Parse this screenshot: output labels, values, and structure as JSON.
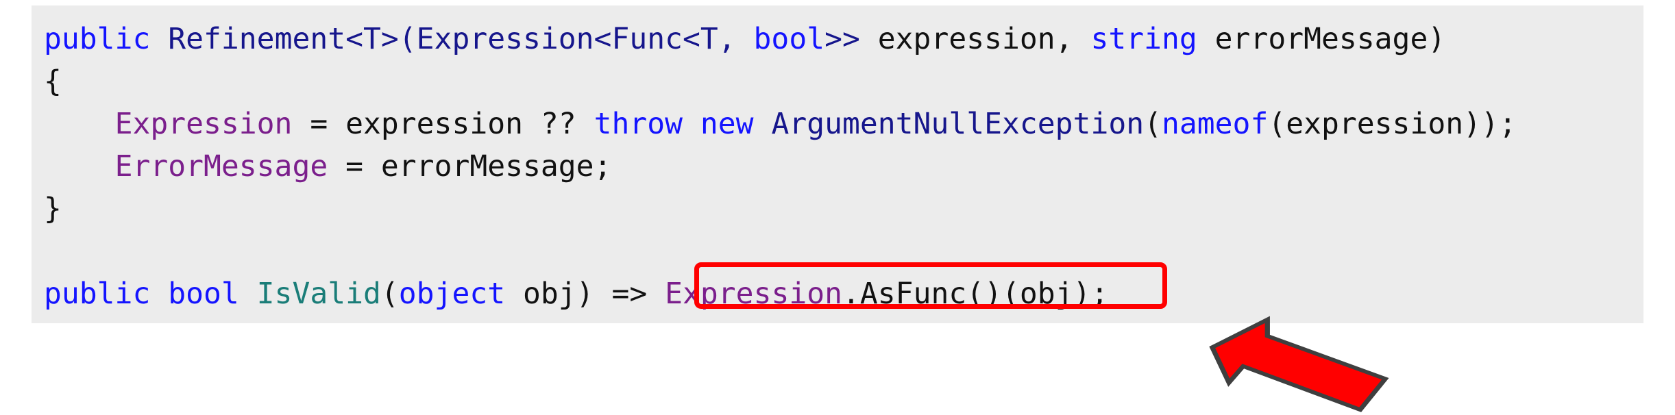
{
  "code_block": {
    "language": "csharp",
    "background_color": "#ececec",
    "lines": [
      {
        "id": "line-1",
        "text": "public Refinement<T>(Expression<Func<T, bool>> expression, string errorMessage)",
        "tokens": [
          {
            "t": "public",
            "c": "kw"
          },
          {
            "t": " ",
            "c": "plain"
          },
          {
            "t": "Refinement<T>(Expression<Func<T,",
            "c": "type"
          },
          {
            "t": " ",
            "c": "plain"
          },
          {
            "t": "bool",
            "c": "kw"
          },
          {
            "t": ">>",
            "c": "type"
          },
          {
            "t": " expression, ",
            "c": "plain"
          },
          {
            "t": "string",
            "c": "kw"
          },
          {
            "t": " errorMessage)",
            "c": "plain"
          }
        ]
      },
      {
        "id": "line-2",
        "text": "{",
        "tokens": [
          {
            "t": "{",
            "c": "plain"
          }
        ]
      },
      {
        "id": "line-3",
        "text": "    Expression = expression ?? throw new ArgumentNullException(nameof(expression));",
        "tokens": [
          {
            "t": "    ",
            "c": "plain"
          },
          {
            "t": "Expression",
            "c": "prop"
          },
          {
            "t": " = expression ?? ",
            "c": "plain"
          },
          {
            "t": "throw new",
            "c": "kw"
          },
          {
            "t": " ",
            "c": "plain"
          },
          {
            "t": "ArgumentNullException",
            "c": "type"
          },
          {
            "t": "(",
            "c": "plain"
          },
          {
            "t": "nameof",
            "c": "kw"
          },
          {
            "t": "(expression));",
            "c": "plain"
          }
        ]
      },
      {
        "id": "line-4",
        "text": "    ErrorMessage = errorMessage;",
        "tokens": [
          {
            "t": "    ",
            "c": "plain"
          },
          {
            "t": "ErrorMessage",
            "c": "prop"
          },
          {
            "t": " = errorMessage;",
            "c": "plain"
          }
        ]
      },
      {
        "id": "line-5",
        "text": "}",
        "tokens": [
          {
            "t": "}",
            "c": "plain"
          }
        ]
      },
      {
        "id": "line-6",
        "text": "",
        "tokens": []
      },
      {
        "id": "line-7",
        "text": "public bool IsValid(object obj) => Expression.AsFunc()(obj);",
        "tokens": [
          {
            "t": "public bool",
            "c": "kw"
          },
          {
            "t": " ",
            "c": "plain"
          },
          {
            "t": "IsValid",
            "c": "method"
          },
          {
            "t": "(",
            "c": "plain"
          },
          {
            "t": "object",
            "c": "kw"
          },
          {
            "t": " obj) => ",
            "c": "plain"
          },
          {
            "t": "Expression",
            "c": "prop"
          },
          {
            "t": ".AsFunc()(obj);",
            "c": "plain"
          }
        ]
      }
    ]
  },
  "annotations": {
    "highlight": {
      "label": "Expression.AsFunc()(obj);",
      "color": "#ff0000",
      "shape": "rounded-rectangle"
    },
    "arrow": {
      "direction": "up-left",
      "fill_color": "#ff0000",
      "stroke_color": "#3f3f3f"
    }
  },
  "colors": {
    "keyword": "#1414ff",
    "type": "#16168c",
    "property": "#7b1f8c",
    "method": "#1a7d78",
    "plain": "#111111",
    "code_background": "#ececec",
    "page_background": "#ffffff",
    "accent_red": "#ff0000"
  }
}
